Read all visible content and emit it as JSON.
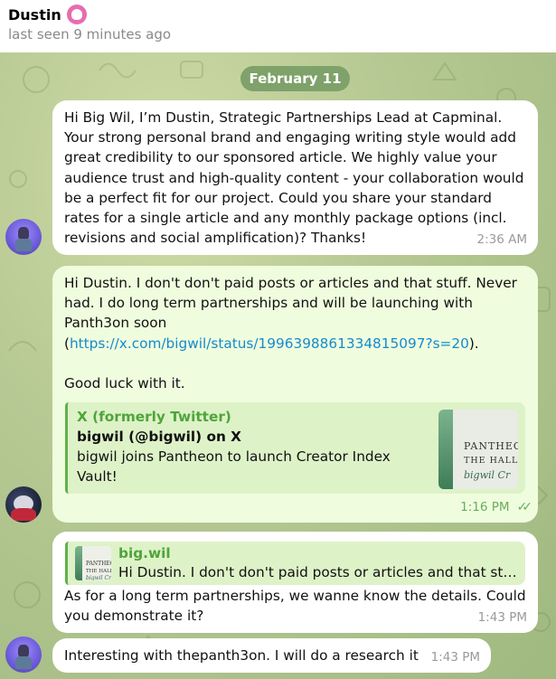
{
  "header": {
    "contact_name": "Dustin",
    "status": "last seen 9 minutes ago"
  },
  "chat": {
    "date_pill": "February 11",
    "messages": [
      {
        "direction": "incoming",
        "text": "Hi Big Wil, I’m Dustin, Strategic Partnerships Lead at Capminal. Your strong personal brand and engaging writing style would add great credibility to our sponsored article. We highly value your audience trust and high-quality content - your collaboration would be a perfect fit for our project. Could you share your standard rates for a single article and any monthly package options (incl. revisions and social amplification)? Thanks!",
        "time": "2:36 AM"
      },
      {
        "direction": "outgoing",
        "text_before_link": "Hi Dustin. I don't don't paid posts or articles and that stuff. Never had. I do long term partnerships and will be launching with Panth3on soon\n(",
        "link": "https://x.com/bigwil/status/1996398861334815097?s=20",
        "text_after_link": ").\n\nGood luck with it.",
        "preview": {
          "site": "X (formerly Twitter)",
          "title": "bigwil (@bigwil) on X",
          "description": "bigwil joins Pantheon to launch Creator Index Vault!",
          "thumb_line1": "PANTHEC",
          "thumb_line2": "THE HALL",
          "thumb_line3": "bigwil Cr"
        },
        "time": "1:16 PM",
        "status": "read"
      },
      {
        "direction": "incoming",
        "reply_to": {
          "name": "big.wil",
          "text": "Hi Dustin. I don't don't paid posts or articles and that stu..."
        },
        "text": "As for a long term partnerships, we wanne know the details. Could you demonstrate it?",
        "time": "1:43 PM"
      },
      {
        "direction": "incoming",
        "text": "Interesting with thepanth3on. I will do a research it",
        "time": "1:43 PM"
      }
    ]
  },
  "colors": {
    "chat_bg": "#b7c994",
    "outgoing_bubble": "#effdde",
    "incoming_bubble": "#ffffff",
    "accent_green": "#4ea53a",
    "link": "#168acd",
    "date_pill": "#7ea26a"
  }
}
